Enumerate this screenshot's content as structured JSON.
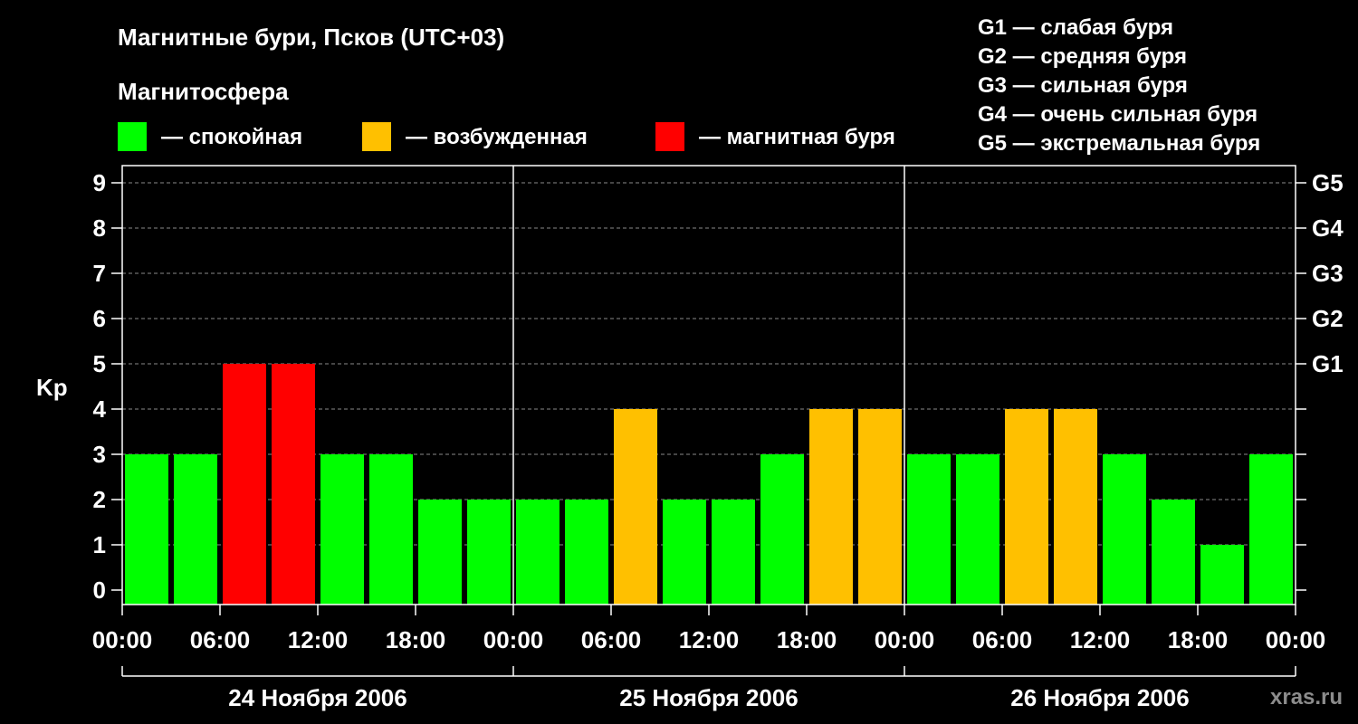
{
  "title": "Магнитные бури, Псков (UTC+03)",
  "legend": {
    "heading": "Магнитосфера",
    "items": [
      {
        "label": "— спокойная",
        "color": "#00ff00"
      },
      {
        "label": "— возбужденная",
        "color": "#ffc000"
      },
      {
        "label": "— магнитная буря",
        "color": "#ff0000"
      }
    ],
    "storm_levels": [
      "G1 — слабая буря",
      "G2 — средняя буря",
      "G3 — сильная буря",
      "G4 — очень сильная буря",
      "G5 — экстремальная буря"
    ]
  },
  "watermark": "xras.ru",
  "chart_data": {
    "type": "bar",
    "ylabel": "Kp",
    "xlabel": "",
    "ylim": [
      0,
      9
    ],
    "y_ticks": [
      "0",
      "1",
      "2",
      "3",
      "4",
      "5",
      "6",
      "7",
      "8",
      "9"
    ],
    "right_ticks": [
      {
        "value": 5,
        "label": "G1"
      },
      {
        "value": 6,
        "label": "G2"
      },
      {
        "value": 7,
        "label": "G3"
      },
      {
        "value": 8,
        "label": "G4"
      },
      {
        "value": 9,
        "label": "G5"
      }
    ],
    "grid": true,
    "x_tick_labels": [
      "00:00",
      "06:00",
      "12:00",
      "18:00",
      "00:00",
      "06:00",
      "12:00",
      "18:00",
      "00:00",
      "06:00",
      "12:00",
      "18:00",
      "00:00"
    ],
    "days": [
      "24 Ноября 2006",
      "25 Ноября 2006",
      "26 Ноября 2006"
    ],
    "interval_hours": 3,
    "values": [
      3,
      3,
      5,
      5,
      3,
      3,
      2,
      2,
      2,
      2,
      4,
      2,
      2,
      3,
      4,
      4,
      3,
      3,
      4,
      4,
      3,
      2,
      1,
      3
    ],
    "colors": {
      "quiet": "#00ff00",
      "unsettled": "#ffc000",
      "storm": "#ff0000"
    }
  }
}
